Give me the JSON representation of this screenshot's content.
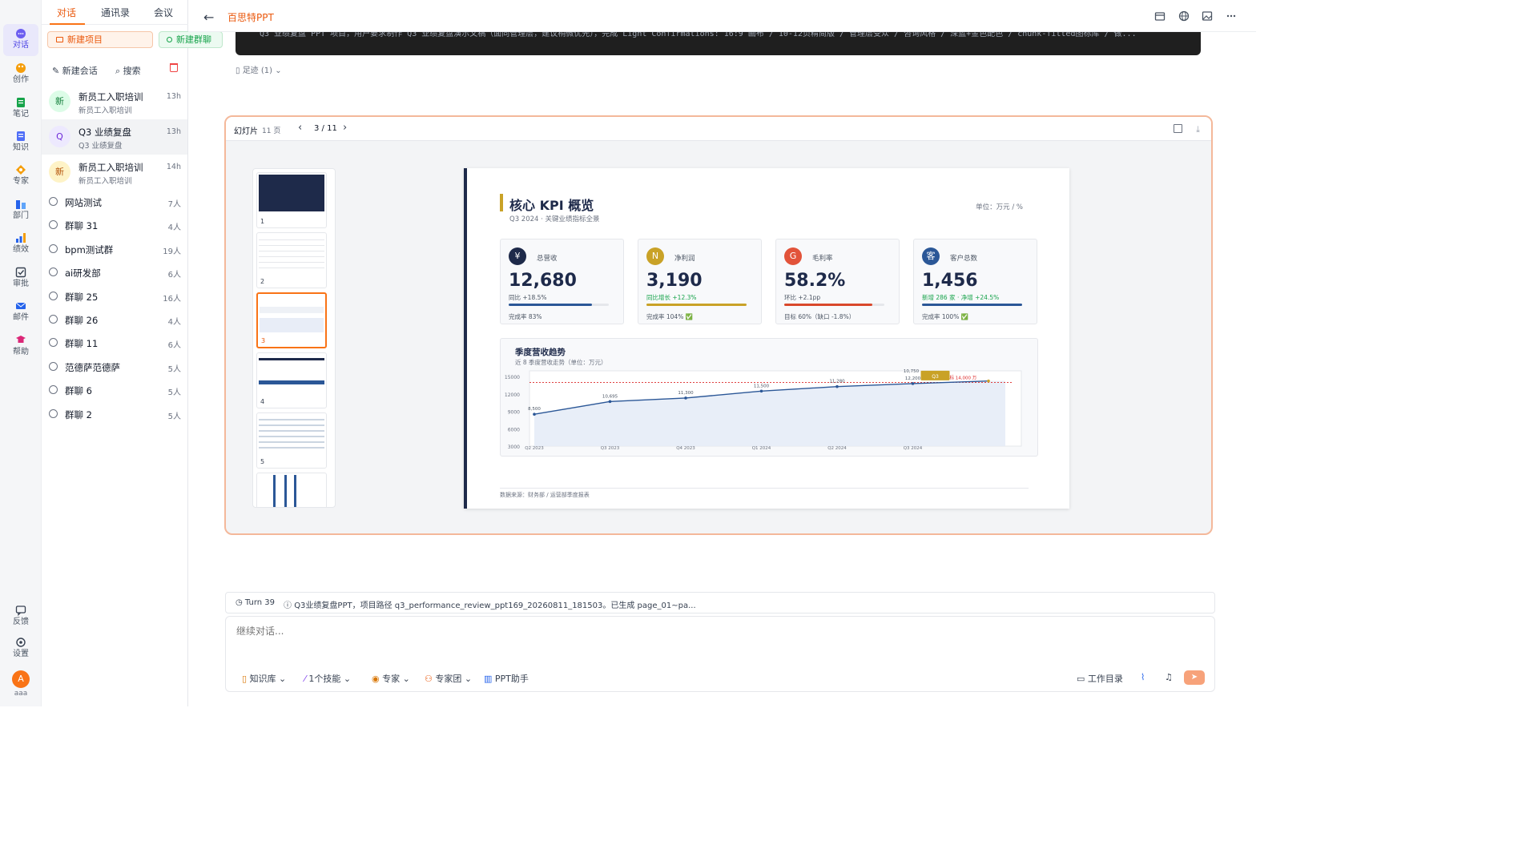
{
  "rail": {
    "items": [
      {
        "label": "对话",
        "icon": "chat-icon"
      },
      {
        "label": "创作",
        "icon": "palette-icon"
      },
      {
        "label": "笔记",
        "icon": "note-icon"
      },
      {
        "label": "知识",
        "icon": "book-icon"
      },
      {
        "label": "专家",
        "icon": "expert-icon"
      },
      {
        "label": "部门",
        "icon": "department-icon"
      },
      {
        "label": "绩效",
        "icon": "bar-chart-icon"
      },
      {
        "label": "审批",
        "icon": "checkbox-icon"
      },
      {
        "label": "邮件",
        "icon": "mail-icon"
      },
      {
        "label": "帮助",
        "icon": "help-icon"
      }
    ],
    "feedback": "反馈",
    "settings": "设置",
    "avatar_letter": "A",
    "avatar_name": "aaa"
  },
  "sidebar": {
    "tabs": [
      "对话",
      "通讯录",
      "会议"
    ],
    "new_project": "新建项目",
    "new_group": "新建群聊",
    "new_chat": "新建会话",
    "search": "搜索",
    "conversations": [
      {
        "avatar": "新",
        "title": "新员工入职培训",
        "subtitle": "新员工入职培训",
        "time": "13h"
      },
      {
        "avatar": "Q",
        "title": "Q3 业绩复盘",
        "subtitle": "Q3 业绩复盘",
        "time": "13h"
      },
      {
        "avatar": "新",
        "title": "新员工入职培训",
        "subtitle": "新员工入职培训",
        "time": "14h"
      }
    ],
    "groups": [
      {
        "name": "网站测试",
        "count": "7人"
      },
      {
        "name": "群聊 31",
        "count": "4人"
      },
      {
        "name": "bpm测试群",
        "count": "19人"
      },
      {
        "name": "ai研发部",
        "count": "6人"
      },
      {
        "name": "群聊 25",
        "count": "16人"
      },
      {
        "name": "群聊 26",
        "count": "4人"
      },
      {
        "name": "群聊 11",
        "count": "6人"
      },
      {
        "name": "范德萨范德萨",
        "count": "5人"
      },
      {
        "name": "群聊 6",
        "count": "5人"
      },
      {
        "name": "群聊 2",
        "count": "5人"
      }
    ]
  },
  "header": {
    "back": "←",
    "title": "百思特PPT",
    "icons": [
      "archive-icon",
      "globe-icon",
      "image-icon",
      "more-icon"
    ]
  },
  "codeblock": {
    "text": "Q3 业绩复盘 PPT 项目，用户要求制作 Q3 业绩复盘演示文稿（面向管理层，建议稍微优先），完成 Light Confirmations: 16:9 画布 / 10-12页精简版 / 管理层受众 / 咨询风格 / 深蓝+金色配色 / chunk-fitted图标库 / 做..."
  },
  "footprint": "足迹 (1)",
  "viewer": {
    "label": "幻灯片",
    "count": "11 页",
    "page": "3 / 11",
    "thumbs": [
      "1",
      "2",
      "3",
      "4",
      "5",
      ""
    ],
    "selected_thumb": 3
  },
  "slide": {
    "title": "核心 KPI 概览",
    "subtitle": "Q3 2024 · 关键业绩指标全景",
    "unit": "单位：万元 / %",
    "kpis": [
      {
        "badge": "¥",
        "name": "总营收",
        "value": "12,680",
        "delta": "同比 +18.5%",
        "progress": 0.83,
        "footer": "完成率 83%",
        "color": "#2b5797",
        "badge_color": "#1e2a4a",
        "delta_color": "#4b5563"
      },
      {
        "badge": "N",
        "name": "净利润",
        "value": "3,190",
        "delta": "同比增长 +12.3%",
        "progress": 1.0,
        "footer": "完成率 104% ✅",
        "color": "#c9a227",
        "badge_color": "#c9a227",
        "delta_color": "#16a34a"
      },
      {
        "badge": "G",
        "name": "毛利率",
        "value": "58.2%",
        "delta": "环比 +2.1pp",
        "progress": 0.88,
        "footer": "目标 60%（缺口 -1.8%）",
        "color": "#d9482b",
        "badge_color": "#e2533a",
        "delta_color": "#4b5563"
      },
      {
        "badge": "客",
        "name": "客户总数",
        "value": "1,456",
        "delta": "新增 286 家 · 净增 +24.5%",
        "progress": 1.0,
        "footer": "完成率 100% ✅",
        "color": "#2b5797",
        "badge_color": "#2b5797",
        "delta_color": "#16a34a"
      }
    ],
    "trend_title": "季度营收趋势",
    "trend_subtitle": "近 8 季度营收走势（单位：万元）",
    "target_label": "目标 14,000 万",
    "highlight_label": "Q3",
    "source": "数据来源：财务部 / 运营部季度报表"
  },
  "chart_data": {
    "type": "line",
    "title": "季度营收趋势",
    "subtitle": "近 8 季度营收走势（单位：万元）",
    "xlabel": "",
    "ylabel": "",
    "x": [
      "Q2 2023",
      "Q3 2023",
      "Q4 2023",
      "Q1 2024",
      "Q2 2024",
      "Q3 2024",
      "Q3"
    ],
    "tick_labels": [
      "Q2 2023",
      "Q3 2023",
      "Q4 2023",
      "Q1 2024",
      "Q2 2024",
      "Q3 2024"
    ],
    "y_ticks": [
      3000,
      6000,
      9000,
      12000,
      15000
    ],
    "series": [
      {
        "values": [
          8500,
          10695,
          11300,
          12500,
          13280,
          13800,
          14250
        ],
        "data_labels": [
          "8,500",
          "10,695",
          "11,300",
          "11,500",
          "11,280",
          "12,200",
          "10,750"
        ]
      }
    ],
    "reference_line": {
      "value": 14000,
      "label": "目标 14,000 万"
    },
    "ylim": [
      3000,
      16000
    ],
    "line_color": "#2b5797",
    "target_color": "#dc2626",
    "highlight_color": "#c9a227"
  },
  "turn": {
    "label": "Turn 39",
    "desc": "Q3业绩复盘PPT，项目路径 q3_performance_review_ppt169_20260811_181503。已生成 page_01~pa..."
  },
  "input": {
    "placeholder": "继续对话...",
    "tools": [
      "知识库",
      "1个技能",
      "专家",
      "专家团",
      "PPT助手"
    ],
    "workdir": "工作目录"
  }
}
